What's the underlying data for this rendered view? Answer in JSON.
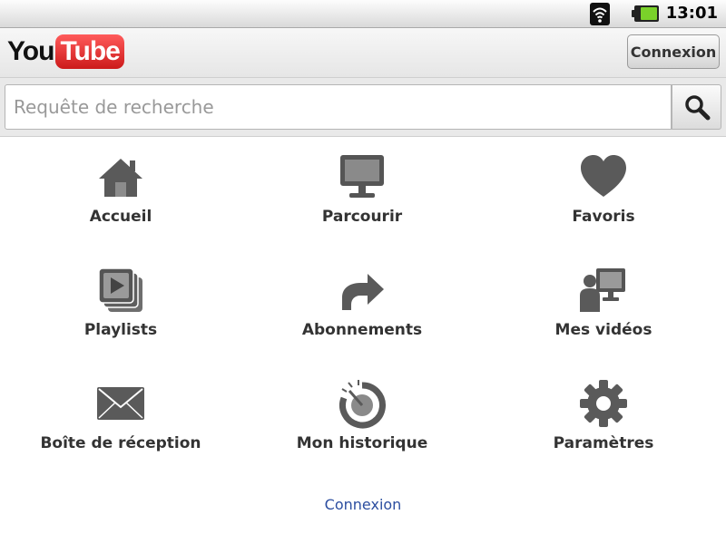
{
  "status_bar": {
    "time": "13:01",
    "icons": [
      "wifi-icon",
      "battery-icon"
    ]
  },
  "header": {
    "logo": {
      "part1": "You",
      "part2": "Tube"
    },
    "login_button": "Connexion"
  },
  "search": {
    "placeholder": "Requête de recherche",
    "button_icon": "search-icon"
  },
  "menu": {
    "items": [
      {
        "label": "Accueil",
        "icon": "home-icon"
      },
      {
        "label": "Parcourir",
        "icon": "monitor-icon"
      },
      {
        "label": "Favoris",
        "icon": "heart-icon"
      },
      {
        "label": "Playlists",
        "icon": "playlist-icon"
      },
      {
        "label": "Abonnements",
        "icon": "share-arrow-icon"
      },
      {
        "label": "Mes vidéos",
        "icon": "person-screen-icon"
      },
      {
        "label": "Boîte de réception",
        "icon": "envelope-icon"
      },
      {
        "label": "Mon historique",
        "icon": "history-icon"
      },
      {
        "label": "Paramètres",
        "icon": "gear-icon"
      }
    ]
  },
  "footer": {
    "link": "Connexion"
  },
  "colors": {
    "brand_red": "#cc1a1a",
    "icon_gray": "#5a5a5a",
    "link_blue": "#2c4ea0",
    "label_text": "#333333"
  }
}
